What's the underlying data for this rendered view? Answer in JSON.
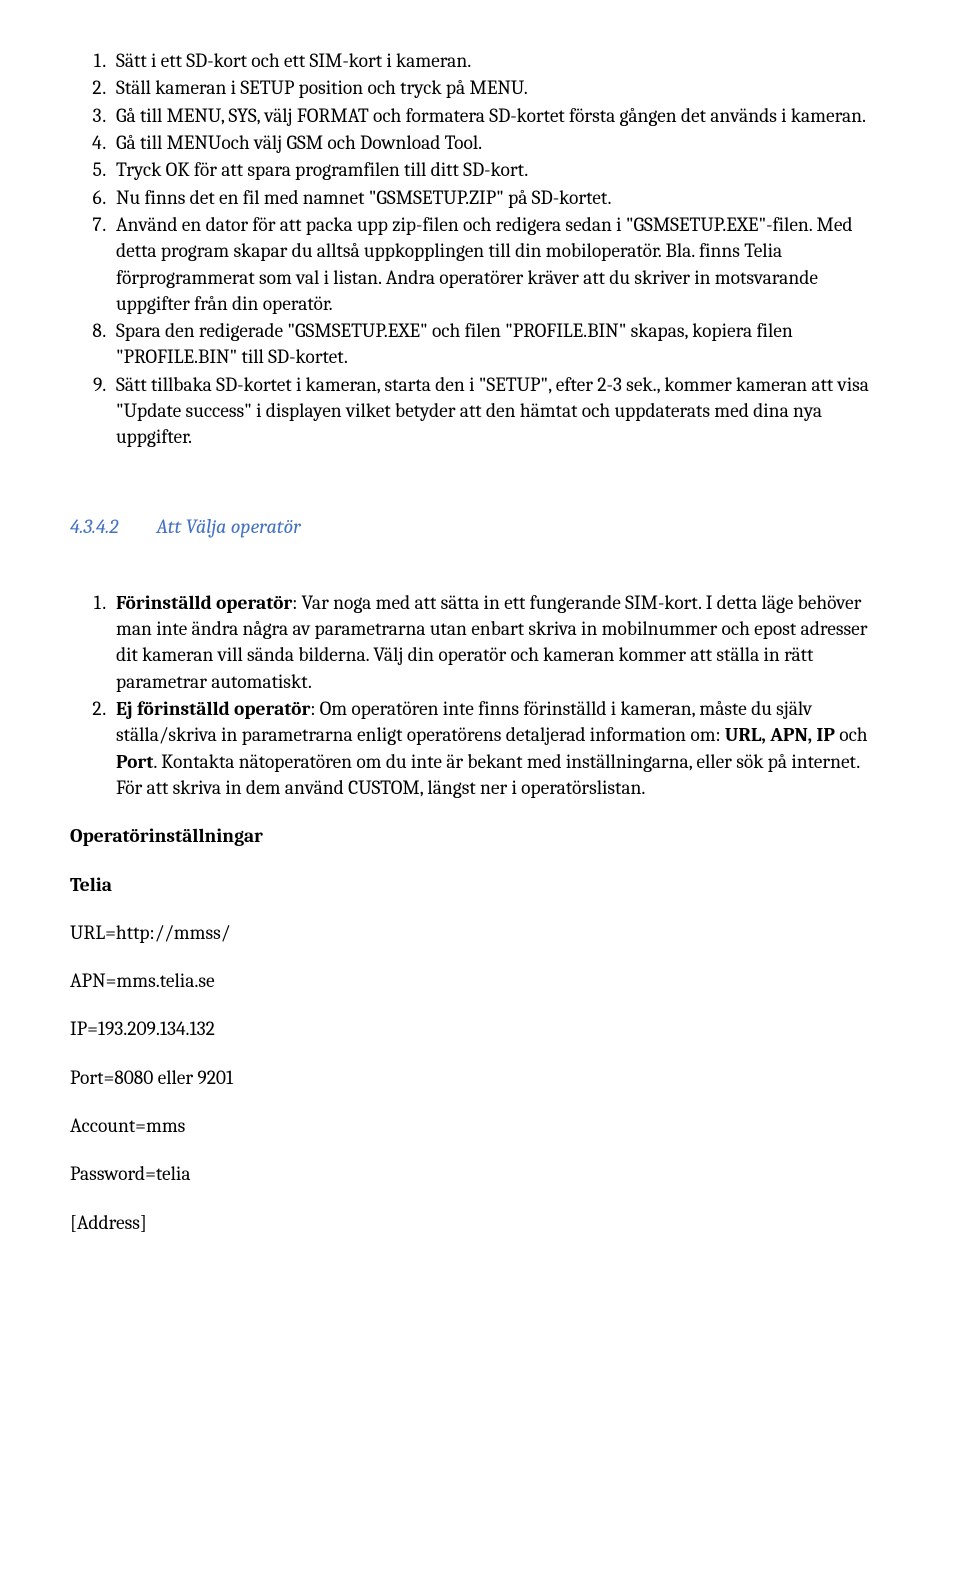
{
  "list1": {
    "items": [
      "Sätt i ett SD-kort och ett SIM-kort i kameran.",
      "Ställ kameran i SETUP position och tryck på MENU.",
      "Gå till MENU, SYS, välj FORMAT och formatera SD-kortet första gången det används i kameran.",
      "Gå till MENUoch välj GSM och Download Tool.",
      "Tryck OK för att spara programfilen till ditt SD-kort.",
      "Nu finns det en fil med namnet \"GSMSETUP.ZIP\" på SD-kortet.",
      "Använd en dator för att packa upp zip-filen och redigera sedan i \"GSMSETUP.EXE\"-filen. Med detta program skapar du alltså uppkopplingen till din mobiloperatör. Bla. finns Telia förprogrammerat som val i listan. Andra operatörer kräver att du skriver in motsvarande uppgifter från din operatör.",
      "Spara den redigerade \"GSMSETUP.EXE\" och filen \"PROFILE.BIN\" skapas, kopiera filen \"PROFILE.BIN\" till SD-kortet.",
      "Sätt tillbaka SD-kortet i kameran, starta den i \"SETUP\", efter 2-3 sek., kommer kameran att visa \"Update success\" i displayen vilket betyder att den hämtat och uppdaterats med dina nya uppgifter."
    ]
  },
  "section": {
    "number": "4.3.4.2",
    "title": "Att Välja operatör"
  },
  "list2": {
    "item1_bold": "Förinställd operatör",
    "item1_rest": ": Var noga med att sätta in ett fungerande SIM-kort. I detta läge behöver man inte ändra några av parametrarna utan enbart skriva in mobilnummer och epost adresser dit kameran vill sända bilderna. Välj din operatör och kameran kommer att ställa in rätt parametrar automatiskt.",
    "item2_bold": "Ej förinställd operatör",
    "item2_mid1": ": Om operatören inte finns förinställd i kameran, måste du själv ställa/skriva in parametrarna enligt operatörens detaljerad information om: ",
    "item2_bold2": "URL, APN, IP",
    "item2_mid2": " och ",
    "item2_bold3": "Port",
    "item2_rest": ". Kontakta nätoperatören om du inte är bekant med inställningarna, eller sök på internet. För att skriva in dem använd CUSTOM, längst ner i operatörslistan."
  },
  "settings": {
    "heading": "Operatörinställningar",
    "provider": "Telia",
    "lines": [
      "URL=http://mmss/",
      "APN=mms.telia.se",
      "IP=193.209.134.132",
      "Port=8080 eller 9201",
      "Account=mms",
      "Password=telia",
      "[Address]"
    ]
  }
}
